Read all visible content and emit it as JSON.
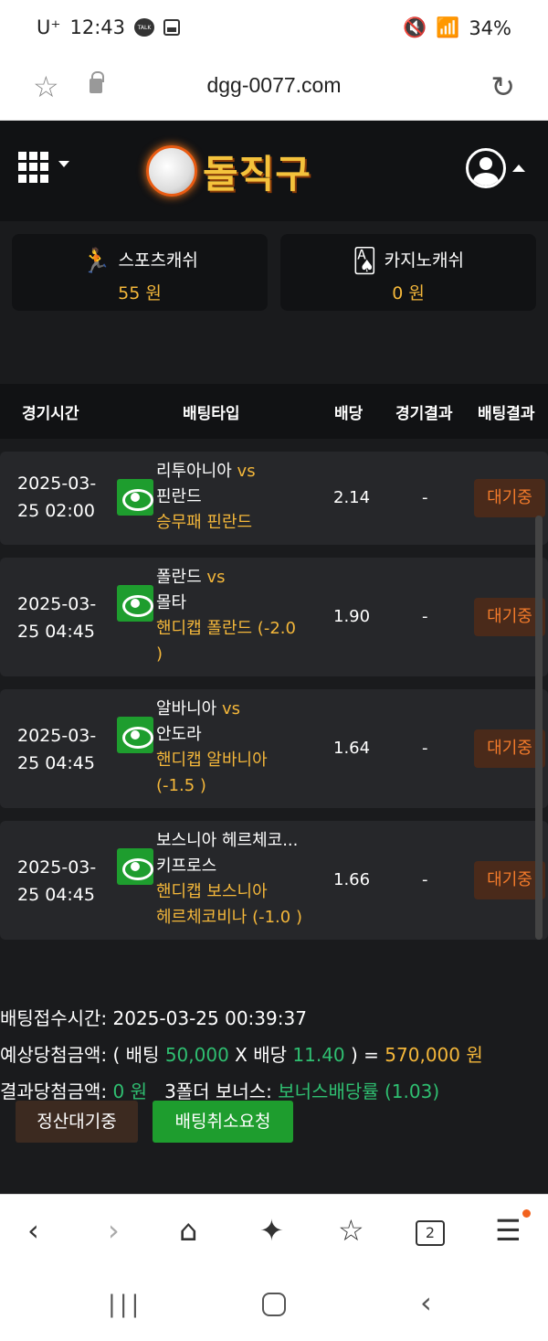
{
  "status_bar": {
    "carrier": "U⁺",
    "time": "12:43",
    "battery": "34%"
  },
  "browser": {
    "url": "dgg-0077.com"
  },
  "site": {
    "logo_text": "돌직구"
  },
  "wallet": {
    "sports_label": "스포츠캐쉬",
    "sports_value": "55 원",
    "casino_label": "카지노캐쉬",
    "casino_value": "0 원"
  },
  "table": {
    "headers": [
      "경기시간",
      "배팅타입",
      "배당",
      "경기결과",
      "배팅결과"
    ],
    "rows": [
      {
        "date_line1": "2025-03-",
        "date_line2": "25 02:00",
        "home": "리투아니아",
        "vs": "vs",
        "away": "핀란드",
        "pick_line1": "승무패 핀란드",
        "pick_line2": "",
        "odds": "2.14",
        "result": "-",
        "status": "대기중"
      },
      {
        "date_line1": "2025-03-",
        "date_line2": "25 04:45",
        "home": "폴란드",
        "vs": "vs",
        "away": "몰타",
        "pick_line1": "핸디캡 폴란드 (-2.0",
        "pick_line2": ")",
        "odds": "1.90",
        "result": "-",
        "status": "대기중"
      },
      {
        "date_line1": "2025-03-",
        "date_line2": "25 04:45",
        "home": "알바니아",
        "vs": "vs",
        "away": "안도라",
        "pick_line1": "핸디캡 알바니아",
        "pick_line2": "(-1.5 )",
        "odds": "1.64",
        "result": "-",
        "status": "대기중"
      },
      {
        "date_line1": "2025-03-",
        "date_line2": "25 04:45",
        "home": "보스니아 헤르체코...",
        "vs": "",
        "away": "키프로스",
        "pick_line1": "핸디캡 보스니아",
        "pick_line2": "헤르체코비나 (-1.0 )",
        "odds": "1.66",
        "result": "-",
        "status": "대기중"
      }
    ]
  },
  "summary": {
    "bet_time_label": "배팅접수시간:",
    "bet_time_value": "2025-03-25 00:39:37",
    "expected_label": "예상당첨금액:",
    "expected_open": "( 배팅",
    "stake": "50,000",
    "x_odds": "X 배당",
    "total_odds": "11.40",
    "expected_close": ") =",
    "expected_amount": "570,000 원",
    "result_label": "결과당첨금액:",
    "result_amount": "0 원",
    "bonus_label": "3폴더 보너스:",
    "bonus_value": "보너스배당률 (1.03)"
  },
  "buttons": {
    "settle": "정산대기중",
    "cancel": "배팅취소요청"
  },
  "bottom_nav": {
    "tab_count": "2"
  }
}
